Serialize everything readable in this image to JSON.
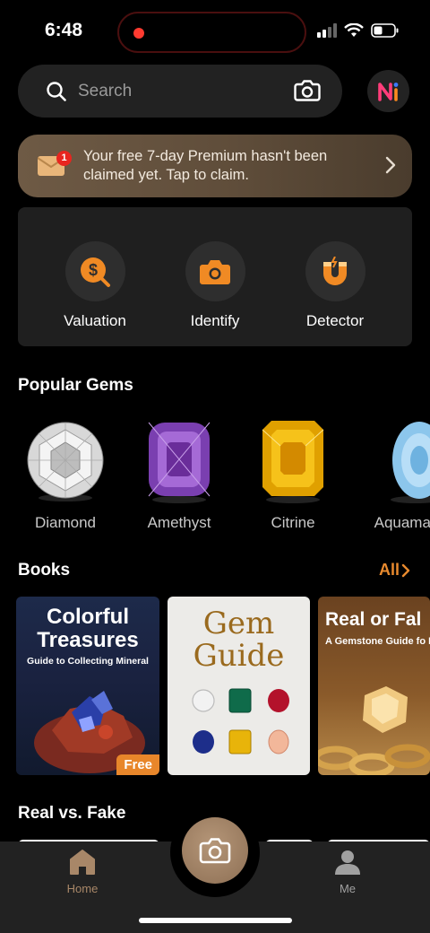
{
  "status": {
    "time": "6:48"
  },
  "search": {
    "placeholder": "Search"
  },
  "promo": {
    "badge_count": "1",
    "text": "Your free 7-day Premium hasn't been claimed yet. Tap to claim."
  },
  "tools": [
    {
      "label": "Valuation",
      "icon": "dollar-search-icon"
    },
    {
      "label": "Identify",
      "icon": "camera-icon"
    },
    {
      "label": "Detector",
      "icon": "magnet-icon"
    }
  ],
  "popular": {
    "title": "Popular Gems",
    "gems": [
      {
        "name": "Diamond"
      },
      {
        "name": "Amethyst"
      },
      {
        "name": "Citrine"
      },
      {
        "name": "Aquamari"
      }
    ]
  },
  "books": {
    "title": "Books",
    "all_label": "All",
    "items": [
      {
        "title": "Colorful Treasures",
        "subtitle": "Guide to Collecting Mineral",
        "tag": "Free"
      },
      {
        "title": "Gem Guide"
      },
      {
        "title": "Real or Fal",
        "subtitle": "A Gemstone Guide fo Enthusiasts"
      }
    ]
  },
  "realfake": {
    "title": "Real vs. Fake"
  },
  "tabbar": {
    "home": "Home",
    "me": "Me"
  },
  "colors": {
    "accent": "#e88a2e",
    "promo_bg": "#6e5a45",
    "card_bg": "#1f1f1f"
  }
}
